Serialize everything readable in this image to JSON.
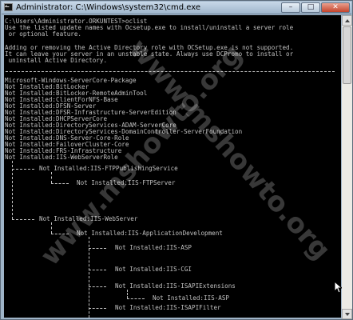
{
  "window": {
    "title": "Administrator: C:\\Windows\\system32\\cmd.exe",
    "controls": {
      "minimize": "–",
      "maximize": "□",
      "close": "✕"
    }
  },
  "console": {
    "lines": [
      "C:\\Users\\Administrator.ORKUNTEST>oclist",
      "Use the listed update names with Ocsetup.exe to install/uninstall a server role",
      " or optional feature.",
      "",
      "Adding or removing the Active Directory role with OCSetup.exe is not supported.",
      "It can leave your server in an unstable state. Always use DCPromo to install or",
      " uninstall Active Directory.",
      "",
      "",
      "Microsoft-Windows-ServerCore-Package",
      "Not Installed:BitLocker",
      "Not Installed:BitLocker-RemoteAdminTool",
      "Not Installed:ClientForNFS-Base",
      "Not Installed:DFSN-Server",
      "Not Installed:DFSR-Infrastructure-ServerEdition",
      "Not Installed:DHCPServerCore",
      "Not Installed:DirectoryServices-ADAM-ServerCore",
      "Not Installed:DirectoryServices-DomainController-ServerFoundation",
      "Not Installed:DNS-Server-Core-Role",
      "Not Installed:FailoverCluster-Core",
      "Not Installed:FRS-Infrastructure",
      "Not Installed:IIS-WebServerRole"
    ],
    "tree": [
      {
        "text": "Not Installed:IIS-FTPPublishingService"
      },
      {
        "text": "Not Installed:IIS-FTPServer"
      },
      {
        "text": "Not Installed:IIS-WebServer"
      },
      {
        "text": "Not Installed:IIS-ApplicationDevelopment"
      },
      {
        "text": "Not Installed:IIS-ASP"
      },
      {
        "text": "Not Installed:IIS-CGI"
      },
      {
        "text": "Not Installed:IIS-ISAPIExtensions"
      },
      {
        "text": "Not Installed:IIS-ASP"
      },
      {
        "text": "Not Installed:IIS-ISAPIFilter"
      }
    ]
  },
  "watermark": "www.mshowto.org",
  "colors": {
    "console_bg": "#000000",
    "console_fg": "#c0c0c0",
    "titlebar": "#b4c7da"
  }
}
